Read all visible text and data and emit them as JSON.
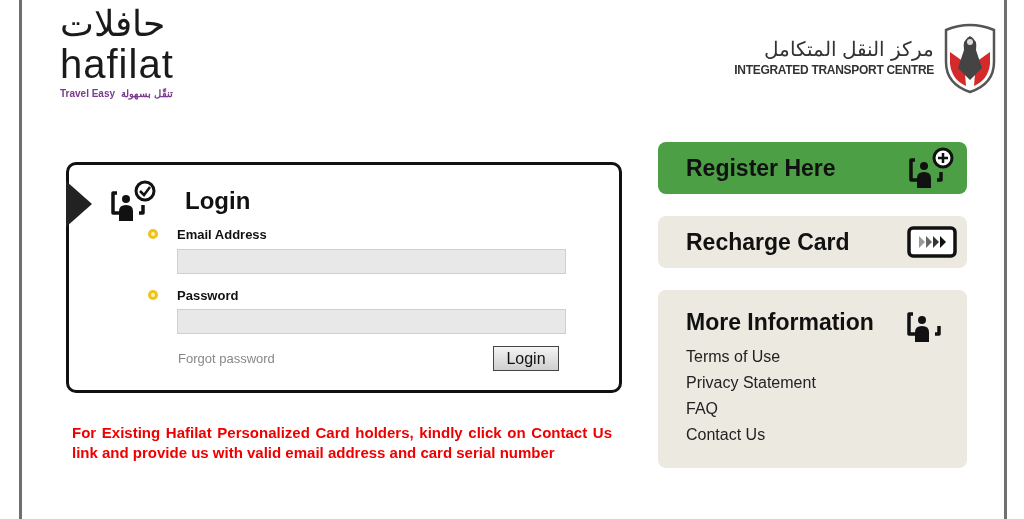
{
  "header": {
    "hafilat_logo": {
      "arabic": "حافلات",
      "name": "hafilat",
      "tagline_en": "Travel Easy",
      "tagline_ar": "تنقّل بسهولة"
    },
    "itc_logo": {
      "arabic": "مركز النقل المتكامل",
      "name": "INTEGRATED TRANSPORT CENTRE"
    }
  },
  "login": {
    "title": "Login",
    "fields": [
      {
        "label": "Email Address",
        "required": true
      },
      {
        "label": "Password",
        "required": true
      }
    ],
    "forgot_link": "Forgot password",
    "submit": "Login"
  },
  "notice": "For Existing Hafilat Personalized Card holders, kindly click on Contact Us link and provide us with valid email address and card serial number",
  "side_buttons": [
    {
      "label": "Register Here",
      "kind": "register"
    },
    {
      "label": "Recharge Card",
      "kind": "recharge"
    }
  ],
  "more_info": {
    "title": "More Information",
    "links": [
      "Terms of Use",
      "Privacy Statement",
      "FAQ",
      "Contact Us"
    ]
  }
}
